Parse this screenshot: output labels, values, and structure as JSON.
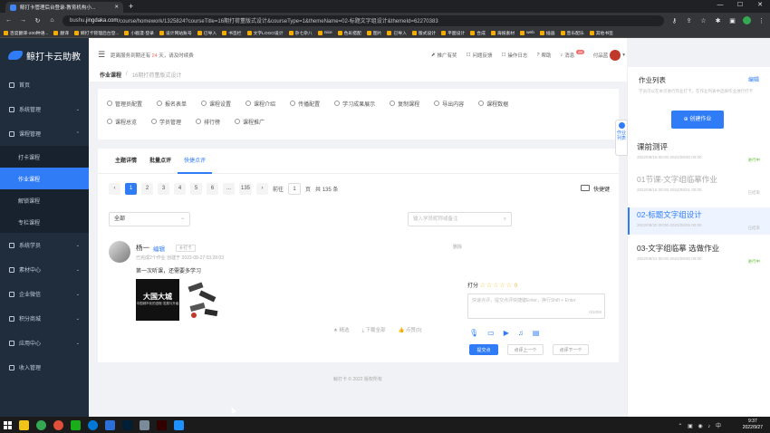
{
  "browser": {
    "tab_title": "鲸打卡管理后台登录-教育机构小...",
    "url_prefix": "bushu.",
    "url_host": "jingdaka.com",
    "url_path": "/course/homework/1325824?courseTitle=16期打荷董版式设计&courseType=1&themeName=02-标题文字组设计&themeId=62270383",
    "bookmarks": [
      "百度翻译-200种语...",
      "翻译",
      "鲸打卡管理后台登...",
      "小戳漫·登录",
      "设计网站账号",
      "已导入",
      "书签栏",
      "文字LOGO设计",
      "杂七杂八",
      "nice",
      "色彩搭配",
      "图片",
      "已导入",
      "版式设计",
      "平面设计",
      "合成",
      "海报素材",
      "web",
      "插画",
      "音乐配乐",
      "其他书签"
    ]
  },
  "sidebar": {
    "logo": "鲸打卡云助教",
    "items": [
      {
        "label": "首页",
        "arrow": ""
      },
      {
        "label": "系统管理",
        "arrow": "⌄"
      },
      {
        "label": "课程管理",
        "arrow": "⌃"
      }
    ],
    "subitems": [
      "打卡课程",
      "作业课程",
      "解锁课程",
      "专栏课程"
    ],
    "items2": [
      {
        "label": "系统学员",
        "arrow": "⌄"
      },
      {
        "label": "素材中心",
        "arrow": "⌄"
      },
      {
        "label": "企业微信",
        "arrow": "⌄"
      },
      {
        "label": "积分商城",
        "arrow": "⌄"
      },
      {
        "label": "应用中心",
        "arrow": "⌄"
      },
      {
        "label": "收入管理",
        "arrow": ""
      }
    ]
  },
  "topbar": {
    "notice_pre": "距离服务到期还有",
    "notice_days": "24",
    "notice_post": "天，请及时续费",
    "links": [
      "推广有奖",
      "问题反馈",
      "操作日志",
      "帮助",
      "消息"
    ],
    "msg_badge": "99",
    "username": "付品蓝"
  },
  "breadcrumb": {
    "root": "作业课程",
    "sep": "/",
    "current": "16期打荷董版式设计"
  },
  "menu": {
    "row1": [
      "管理员配置",
      "报名表单",
      "课程设置",
      "课程介绍",
      "传播配置",
      "学习成果展示",
      "复制课程",
      "导出内容",
      "课程数据"
    ],
    "row2": [
      "课程总览",
      "学员管理",
      "排行榜",
      "课程推广"
    ]
  },
  "tabs": [
    "主题详情",
    "批量点评",
    "快捷点评"
  ],
  "pager": {
    "pages": [
      "1",
      "2",
      "3",
      "4",
      "5",
      "6",
      "...",
      "135"
    ],
    "goto_label": "前往",
    "goto_value": "1",
    "page_unit": "页",
    "total": "共 135 条",
    "quick_label": "快捷键"
  },
  "filter": {
    "select_value": "全部",
    "search_placeholder": "输入学员昵称或备注"
  },
  "post": {
    "name": "杨一",
    "edit": "编辑",
    "tag": "补打卡",
    "delete": "删除",
    "meta": "已完成2个作业  创建于 2022-08-27 03:28:03",
    "text": "第一次听课，还需要多学习",
    "img_title": "大国大城",
    "img_sub": "中国城市化的进程·发展与升级",
    "actions": [
      "精选",
      "下载全部",
      "点赞(0)"
    ]
  },
  "score": {
    "label": "打分",
    "stars": "☆☆☆☆☆",
    "value": "0",
    "placeholder": "快速点评，提交点评快捷键Enter，换行Shift + Enter",
    "count": "0/1000",
    "submit": "提交点评",
    "prev": "点评上一个",
    "next": "点评下一个"
  },
  "rpanel": {
    "title": "作业列表",
    "edit": "编辑",
    "desc": "学员可以在本页进行作业打卡，在作业列表中选择作业进行打卡",
    "create": "创建作业",
    "collapse": "作业列表",
    "tasks": [
      {
        "name": "课前测评",
        "time": "2022/08/16 08:00-2022/09/30 00:00",
        "status": "进行中"
      },
      {
        "name": "01节课-文字组临摹作业",
        "time": "2022/08/16 08:00-2022/09/21 00:00",
        "status": "已结束"
      },
      {
        "name": "02-标题文字组设计",
        "time": "2022/08/20 08:00-2022/09/26 00:00",
        "status": "已结束"
      },
      {
        "name": "03-文字组临摹 选做作业",
        "time": "2022/08/22 08:00-2022/09/30 00:00",
        "status": "进行中"
      }
    ]
  },
  "footer": "鲸打卡 © 2022 版权所有",
  "taskbar": {
    "time": "9:37",
    "date": "2022/9/27",
    "ime": "中"
  }
}
